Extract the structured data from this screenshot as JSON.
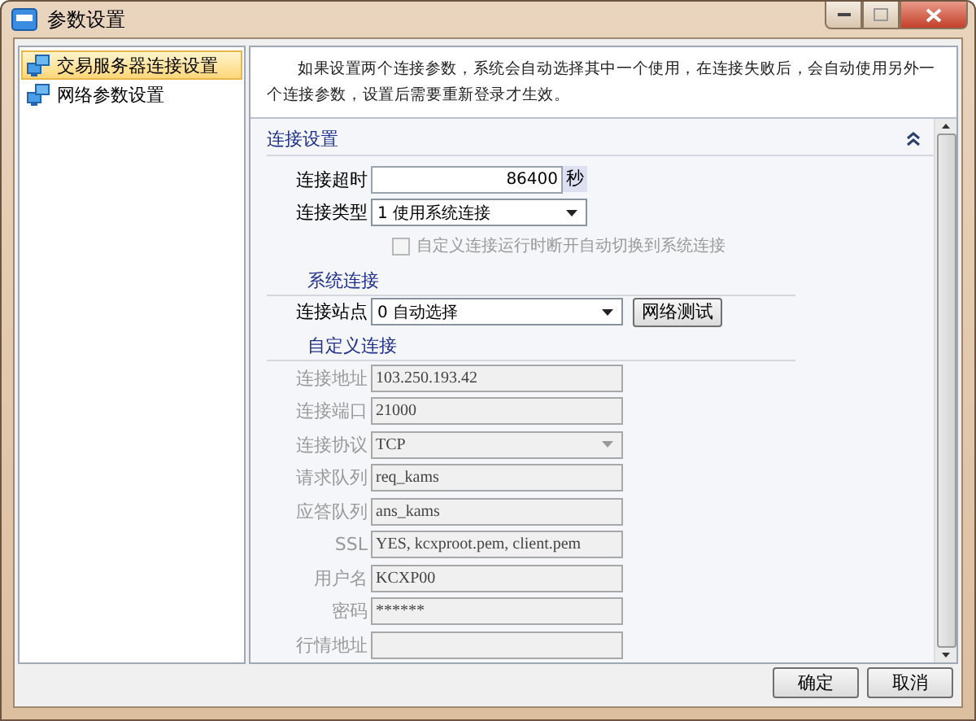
{
  "window": {
    "title": "参数设置"
  },
  "sidebar": {
    "items": [
      {
        "label": "交易服务器连接设置",
        "selected": true
      },
      {
        "label": "网络参数设置",
        "selected": false
      }
    ]
  },
  "description": "如果设置两个连接参数，系统会自动选择其中一个使用，在连接失败后，会自动使用另外一个连接参数，设置后需要重新登录才生效。",
  "form": {
    "title": "连接设置",
    "expanded": true,
    "timeout": {
      "label": "连接超时",
      "value": "86400",
      "unit": "秒"
    },
    "conn_type": {
      "label": "连接类型",
      "value": "1 使用系统连接"
    },
    "auto_switch": {
      "label": "自定义连接运行时断开自动切换到系统连接",
      "checked": false,
      "disabled": true
    },
    "system": {
      "title": "系统连接",
      "station": {
        "label": "连接站点",
        "value": "0 自动选择"
      },
      "test_button": "网络测试"
    },
    "custom": {
      "title": "自定义连接",
      "fields": [
        {
          "label": "连接地址",
          "value": "103.250.193.42",
          "kind": "text",
          "disabled": true
        },
        {
          "label": "连接端口",
          "value": "21000",
          "kind": "text",
          "disabled": true
        },
        {
          "label": "连接协议",
          "value": "TCP",
          "kind": "select",
          "disabled": true
        },
        {
          "label": "请求队列",
          "value": "req_kams",
          "kind": "text",
          "disabled": true
        },
        {
          "label": "应答队列",
          "value": "ans_kams",
          "kind": "text",
          "disabled": true
        },
        {
          "label": "SSL",
          "value": "YES, kcxproot.pem, client.pem",
          "kind": "text",
          "disabled": true
        },
        {
          "label": "用户名",
          "value": "KCXP00",
          "kind": "text",
          "disabled": true
        },
        {
          "label": "密码",
          "value": "******",
          "kind": "text",
          "disabled": true
        },
        {
          "label": "行情地址",
          "kind": "text",
          "disabled": true
        }
      ]
    }
  },
  "buttons": [
    {
      "label": "确定"
    },
    {
      "label": "取消"
    }
  ]
}
